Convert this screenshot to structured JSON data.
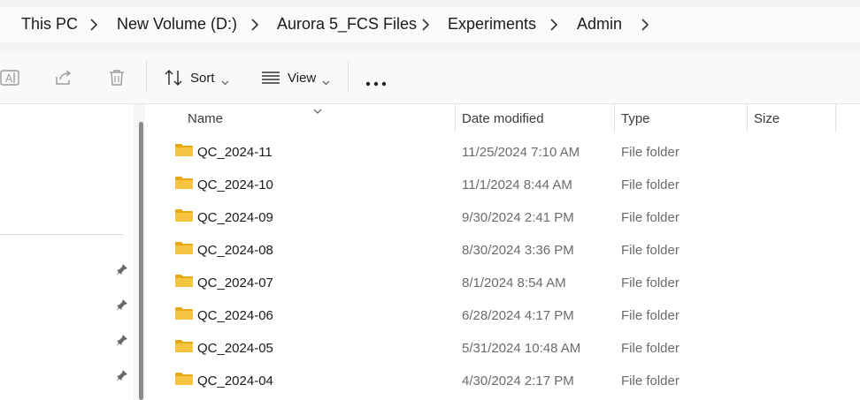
{
  "breadcrumb": {
    "items": [
      "This PC",
      "New Volume (D:)",
      "Aurora 5_FCS Files",
      "Experiments",
      "Admin"
    ]
  },
  "toolbar": {
    "sort_label": "Sort",
    "view_label": "View",
    "icons": [
      "rename-icon",
      "share-icon",
      "delete-icon",
      "sort-icon",
      "view-icon",
      "more-icon"
    ]
  },
  "file_list": {
    "columns": [
      "Name",
      "Date modified",
      "Type",
      "Size"
    ],
    "rows": [
      {
        "name": "QC_2024-11",
        "date": "11/25/2024 7:10 AM",
        "type": "File folder"
      },
      {
        "name": "QC_2024-10",
        "date": "11/1/2024 8:44 AM",
        "type": "File folder"
      },
      {
        "name": "QC_2024-09",
        "date": "9/30/2024 2:41 PM",
        "type": "File folder"
      },
      {
        "name": "QC_2024-08",
        "date": "8/30/2024 3:36 PM",
        "type": "File folder"
      },
      {
        "name": "QC_2024-07",
        "date": "8/1/2024 8:54 AM",
        "type": "File folder"
      },
      {
        "name": "QC_2024-06",
        "date": "6/28/2024 4:17 PM",
        "type": "File folder"
      },
      {
        "name": "QC_2024-05",
        "date": "5/31/2024 10:48 AM",
        "type": "File folder"
      },
      {
        "name": "QC_2024-04",
        "date": "4/30/2024 2:17 PM",
        "type": "File folder"
      }
    ]
  },
  "colors": {
    "folder": "#f5c542",
    "folder_tab": "#e8a917",
    "muted_text": "#6b6b6b"
  }
}
